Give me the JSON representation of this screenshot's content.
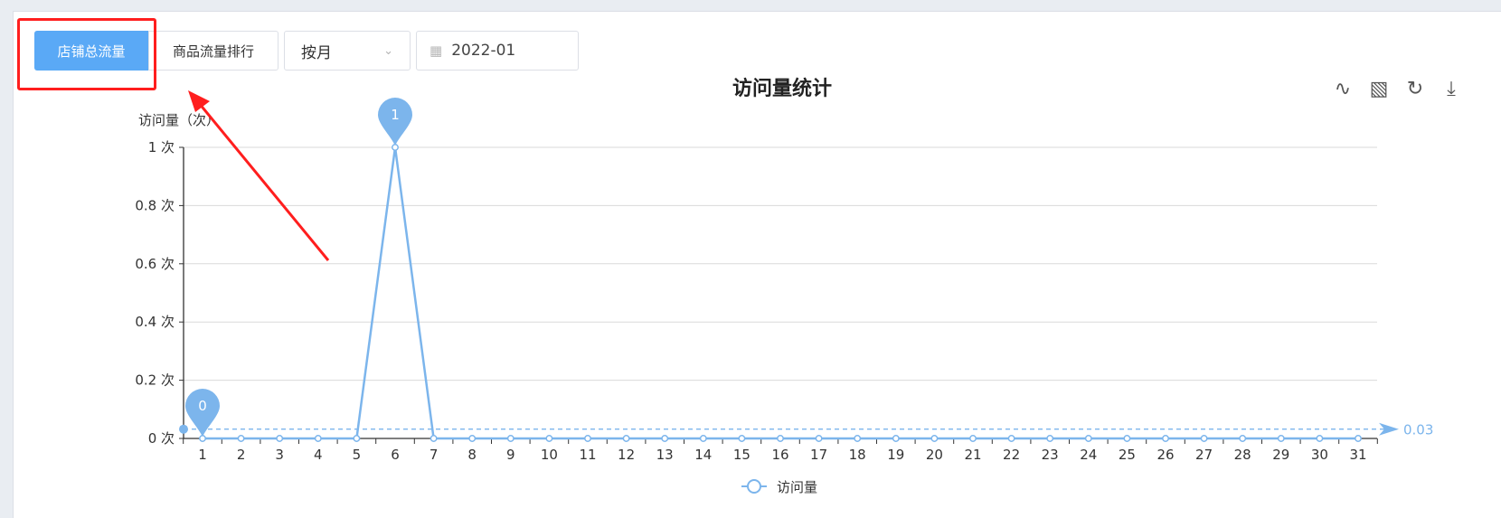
{
  "toolbar": {
    "tab_store": "店铺总流量",
    "tab_goods": "商品流量排行",
    "period_select": "按月",
    "date_value": "2022-01"
  },
  "icons": {
    "line": "line-chart-icon",
    "bar": "bar-chart-icon",
    "refresh": "refresh-icon",
    "download": "download-icon"
  },
  "chart_data": {
    "type": "line",
    "title": "访问量统计",
    "ylabel": "访问量（次）",
    "x": [
      "1",
      "2",
      "3",
      "4",
      "5",
      "6",
      "7",
      "8",
      "9",
      "10",
      "11",
      "12",
      "13",
      "14",
      "15",
      "16",
      "17",
      "18",
      "19",
      "20",
      "21",
      "22",
      "23",
      "24",
      "25",
      "26",
      "27",
      "28",
      "29",
      "30",
      "31"
    ],
    "series": [
      {
        "name": "访问量",
        "values": [
          0,
          0,
          0,
          0,
          0,
          1,
          0,
          0,
          0,
          0,
          0,
          0,
          0,
          0,
          0,
          0,
          0,
          0,
          0,
          0,
          0,
          0,
          0,
          0,
          0,
          0,
          0,
          0,
          0,
          0,
          0
        ]
      }
    ],
    "y_ticks": [
      "0 次",
      "0.2 次",
      "0.4 次",
      "0.6 次",
      "0.8 次",
      "1 次"
    ],
    "ylim": [
      0,
      1
    ],
    "mark_points": [
      {
        "label": "0",
        "x_index": 0,
        "value": 0
      },
      {
        "label": "1",
        "x_index": 5,
        "value": 1
      }
    ],
    "mark_line": {
      "label": "0.03",
      "value": 0.032
    },
    "grid": true,
    "legend": "bottom-center",
    "color": "#7cb5ec"
  }
}
